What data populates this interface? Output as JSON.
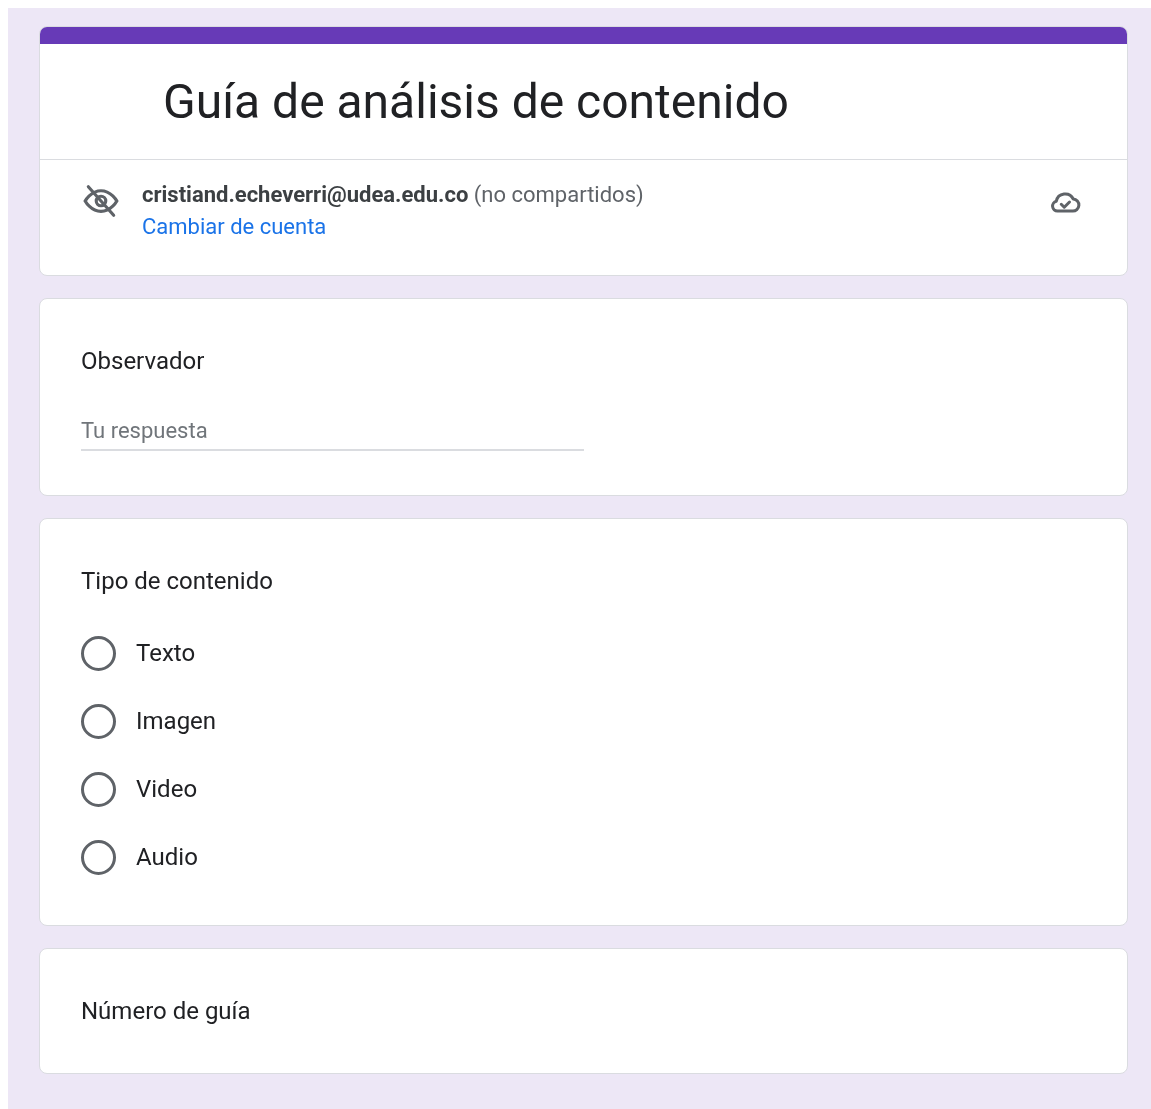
{
  "form": {
    "title": "Guía de análisis de contenido",
    "account": {
      "email": "cristiand.echeverri@udea.edu.co",
      "note": "(no compartidos)",
      "switch_link": "Cambiar de cuenta"
    }
  },
  "questions": [
    {
      "title": "Observador",
      "placeholder": "Tu respuesta"
    },
    {
      "title": "Tipo de contenido",
      "options": [
        {
          "label": "Texto",
          "selected": false
        },
        {
          "label": "Imagen",
          "selected": false
        },
        {
          "label": "Video",
          "selected": false
        },
        {
          "label": "Audio",
          "selected": false
        }
      ]
    },
    {
      "title": "Número de guía"
    }
  ]
}
